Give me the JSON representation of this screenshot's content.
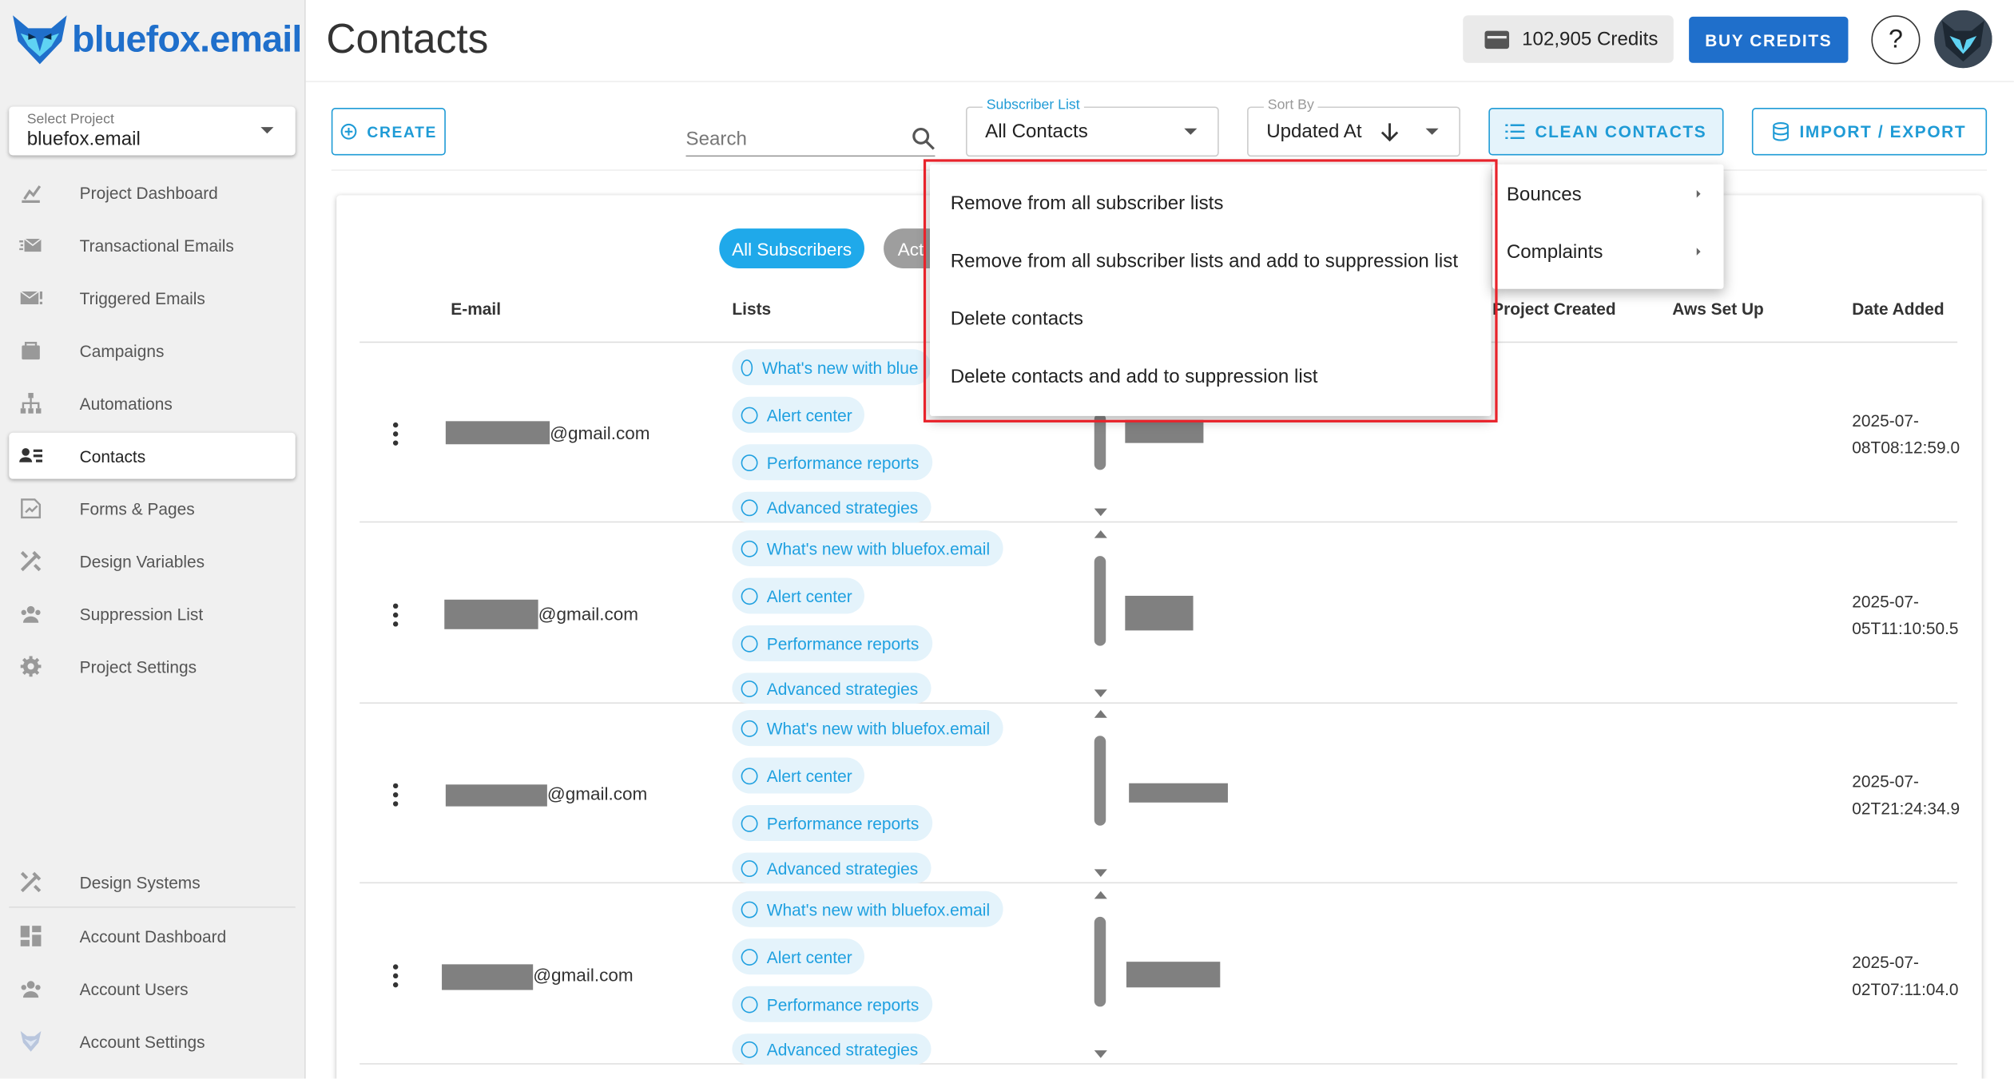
{
  "brand": {
    "logo_text": "bluefox.email"
  },
  "project_select": {
    "label": "Select Project",
    "value": "bluefox.email"
  },
  "sidebar": {
    "items": [
      {
        "label": "Project Dashboard",
        "icon": "chart-icon"
      },
      {
        "label": "Transactional Emails",
        "icon": "email-fast-icon"
      },
      {
        "label": "Triggered Emails",
        "icon": "email-alert-icon"
      },
      {
        "label": "Campaigns",
        "icon": "campaign-icon"
      },
      {
        "label": "Automations",
        "icon": "sitemap-icon"
      },
      {
        "label": "Contacts",
        "icon": "contacts-icon",
        "active": true
      },
      {
        "label": "Forms & Pages",
        "icon": "form-icon"
      },
      {
        "label": "Design Variables",
        "icon": "tools-icon"
      },
      {
        "label": "Suppression List",
        "icon": "users-icon"
      },
      {
        "label": "Project Settings",
        "icon": "gear-icon"
      }
    ],
    "bottom_items": [
      {
        "label": "Design Systems",
        "icon": "tools-icon"
      },
      {
        "label": "Account Dashboard",
        "icon": "dashboard-icon"
      },
      {
        "label": "Account Users",
        "icon": "users-icon"
      },
      {
        "label": "Account Settings",
        "icon": "fox-icon"
      }
    ]
  },
  "header": {
    "title": "Contacts",
    "credits": "102,905 Credits",
    "buy_label": "BUY CREDITS",
    "help_label": "?"
  },
  "toolbar": {
    "create_label": "CREATE",
    "search_placeholder": "Search",
    "subscriber_list": {
      "label": "Subscriber List",
      "value": "All Contacts"
    },
    "sort_by": {
      "label": "Sort By",
      "value": "Updated At"
    },
    "clean_label": "CLEAN CONTACTS",
    "import_label": "IMPORT / EXPORT"
  },
  "filters": {
    "all": "All Subscribers",
    "active": "Act"
  },
  "table": {
    "columns": {
      "email": "E-mail",
      "lists": "Lists",
      "project_created": "Project Created",
      "aws_set_up": "Aws Set Up",
      "date_added": "Date Added"
    },
    "rows": [
      {
        "email_suffix": "@gmail.com",
        "date_line1": "2025-07-",
        "date_line2": "08T08:12:59.0",
        "lists": [
          "What's new with blue",
          "Alert center",
          "Performance reports",
          "Advanced strategies"
        ]
      },
      {
        "email_suffix": "@gmail.com",
        "date_line1": "2025-07-",
        "date_line2": "05T11:10:50.5",
        "lists": [
          "What's new with bluefox.email",
          "Alert center",
          "Performance reports",
          "Advanced strategies"
        ]
      },
      {
        "email_suffix": "@gmail.com",
        "date_line1": "2025-07-",
        "date_line2": "02T21:24:34.9",
        "lists": [
          "What's new with bluefox.email",
          "Alert center",
          "Performance reports",
          "Advanced strategies"
        ]
      },
      {
        "email_suffix": "@gmail.com",
        "date_line1": "2025-07-",
        "date_line2": "02T07:11:04.0",
        "lists": [
          "What's new with bluefox.email",
          "Alert center",
          "Performance reports",
          "Advanced strategies"
        ]
      }
    ]
  },
  "clean_menu": {
    "items": [
      "Remove from all subscriber lists",
      "Remove from all subscriber lists and add to suppression list",
      "Delete contacts",
      "Delete contacts and add to suppression list"
    ],
    "submenu": [
      "Bounces",
      "Complaints"
    ]
  },
  "colors": {
    "accent": "#1f9bd6",
    "primary": "#1f6fcb",
    "highlight": "#e8232b"
  }
}
